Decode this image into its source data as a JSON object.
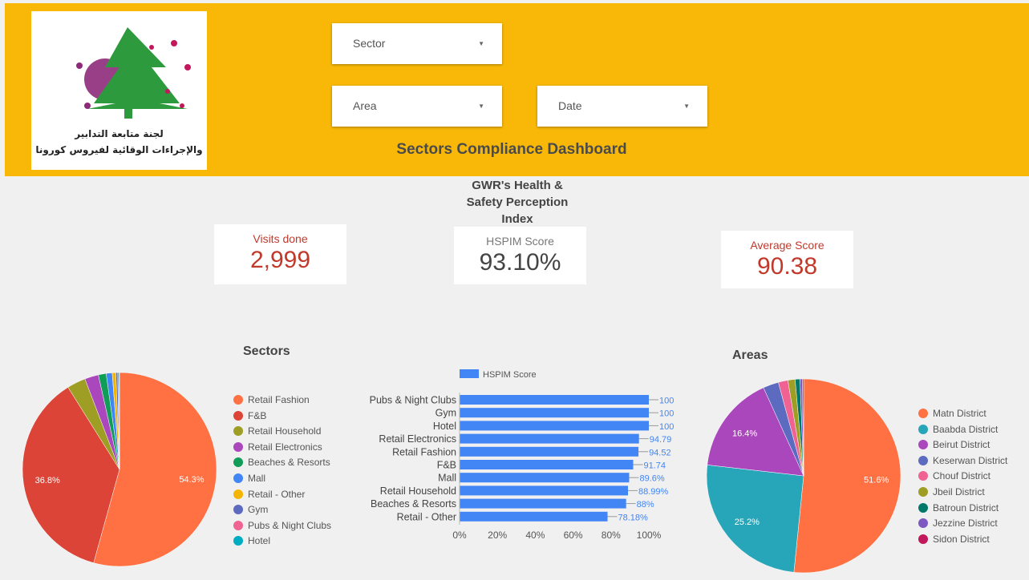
{
  "header": {
    "logo_line1": "لجنة متابعة التدابير",
    "logo_line2": "والإجراءات الوقائية لفيروس كورونا",
    "dashboard_title": "Sectors Compliance Dashboard"
  },
  "filters": {
    "sector": "Sector",
    "area": "Area",
    "date": "Date"
  },
  "gwr_title": [
    "GWR's Health &",
    "Safety Perception",
    "Index"
  ],
  "kpis": {
    "visits": {
      "label": "Visits done",
      "value": "2,999"
    },
    "hspim": {
      "label": "HSPIM Score",
      "value": "93.10%"
    },
    "average": {
      "label": "Average Score",
      "value": "90.38"
    }
  },
  "colors": {
    "header_bg": "#f9b808",
    "kpi_red": "#c0392b",
    "bar_blue": "#4285f4",
    "label_blue": "#4285f4"
  },
  "chart_data": [
    {
      "type": "pie",
      "title": "Sectors",
      "legend_position": "right",
      "slices": [
        {
          "label": "Retail Fashion",
          "value": 54.3,
          "color": "#ff7043",
          "display": "54.3%"
        },
        {
          "label": "F&B",
          "value": 36.8,
          "color": "#db4437",
          "display": "36.8%"
        },
        {
          "label": "Retail Household",
          "value": 3.1,
          "color": "#9e9d24",
          "display": ""
        },
        {
          "label": "Retail Electronics",
          "value": 2.3,
          "color": "#ab47bc",
          "display": ""
        },
        {
          "label": "Beaches & Resorts",
          "value": 1.3,
          "color": "#0f9d58",
          "display": ""
        },
        {
          "label": "Mall",
          "value": 1.0,
          "color": "#4285f4",
          "display": ""
        },
        {
          "label": "Retail - Other",
          "value": 0.6,
          "color": "#f4b400",
          "display": ""
        },
        {
          "label": "Gym",
          "value": 0.3,
          "color": "#5c6bc0",
          "display": ""
        },
        {
          "label": "Pubs & Night Clubs",
          "value": 0.2,
          "color": "#f06292",
          "display": ""
        },
        {
          "label": "Hotel",
          "value": 0.1,
          "color": "#00acc1",
          "display": ""
        }
      ]
    },
    {
      "type": "bar",
      "orientation": "horizontal",
      "legend": "HSPIM Score",
      "legend_position": "top",
      "categories": [
        "Pubs & Night Clubs",
        "Gym",
        "Hotel",
        "Retail Electronics",
        "Retail Fashion",
        "F&B",
        "Mall",
        "Retail Household",
        "Beaches & Resorts",
        "Retail - Other"
      ],
      "values": [
        100,
        100,
        100,
        94.79,
        94.52,
        91.74,
        89.6,
        88.99,
        88,
        78.18
      ],
      "value_labels": [
        "100",
        "100",
        "100",
        "94.79",
        "94.52",
        "91.74",
        "89.6%",
        "88.99%",
        "88%",
        "78.18%"
      ],
      "xticks": [
        "0%",
        "20%",
        "40%",
        "60%",
        "80%",
        "100%"
      ],
      "xlim": [
        0,
        100
      ]
    },
    {
      "type": "pie",
      "title": "Areas",
      "legend_position": "right",
      "slices": [
        {
          "label": "Matn District",
          "value": 51.6,
          "color": "#ff7043",
          "display": "51.6%"
        },
        {
          "label": "Baabda District",
          "value": 25.2,
          "color": "#26a6b8",
          "display": "25.2%"
        },
        {
          "label": "Beirut District",
          "value": 16.4,
          "color": "#ab47bc",
          "display": "16.4%"
        },
        {
          "label": "Keserwan District",
          "value": 2.6,
          "color": "#5c6bc0",
          "display": ""
        },
        {
          "label": "Chouf District",
          "value": 1.6,
          "color": "#f06292",
          "display": ""
        },
        {
          "label": "Jbeil District",
          "value": 1.2,
          "color": "#9e9d24",
          "display": ""
        },
        {
          "label": "Batroun District",
          "value": 0.8,
          "color": "#00796b",
          "display": ""
        },
        {
          "label": "Jezzine District",
          "value": 0.4,
          "color": "#7e57c2",
          "display": ""
        },
        {
          "label": "Sidon District",
          "value": 0.2,
          "color": "#c2185b",
          "display": ""
        }
      ]
    }
  ]
}
